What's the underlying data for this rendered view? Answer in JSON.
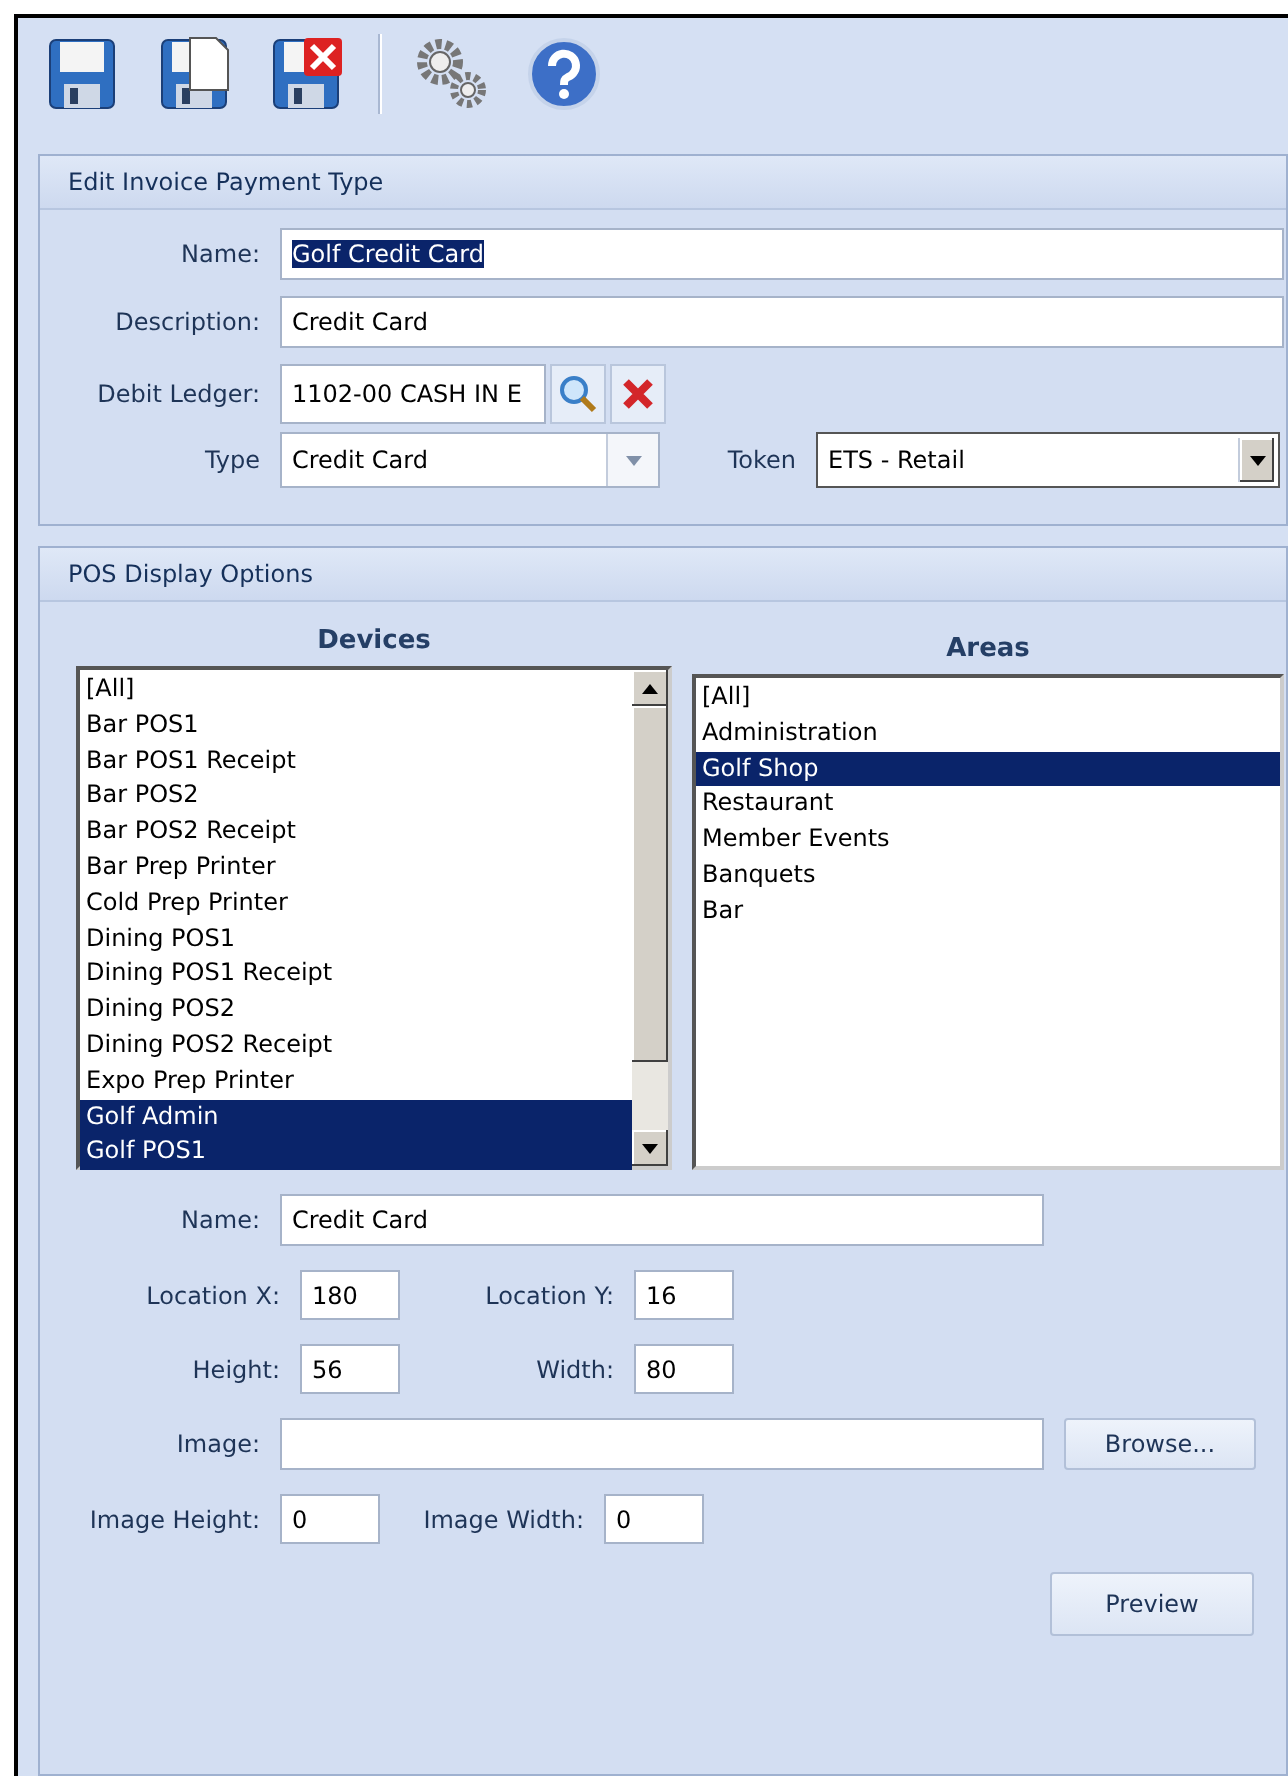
{
  "toolbar": {
    "buttons": [
      {
        "kind": "save"
      },
      {
        "kind": "save-copy"
      },
      {
        "kind": "save-close"
      },
      {
        "kind": "separator"
      },
      {
        "kind": "settings"
      },
      {
        "kind": "help"
      }
    ]
  },
  "edit_panel": {
    "title": "Edit Invoice Payment Type",
    "name": {
      "label": "Name:",
      "value": "Golf Credit Card",
      "text_selected": true
    },
    "description": {
      "label": "Description:",
      "value": "Credit Card"
    },
    "debit_ledger": {
      "label": "Debit Ledger:",
      "value": "1102-00 CASH IN E"
    },
    "type": {
      "label": "Type",
      "value": "Credit Card"
    },
    "token": {
      "label": "Token",
      "value": "ETS - Retail"
    }
  },
  "pos_panel": {
    "title": "POS Display Options",
    "devices": {
      "title": "Devices",
      "items": [
        {
          "label": "[All]",
          "selected": false
        },
        {
          "label": "Bar POS1",
          "selected": false
        },
        {
          "label": "Bar POS1 Receipt",
          "selected": false
        },
        {
          "label": "Bar POS2",
          "selected": false
        },
        {
          "label": "Bar POS2 Receipt",
          "selected": false
        },
        {
          "label": "Bar Prep Printer",
          "selected": false
        },
        {
          "label": "Cold Prep Printer",
          "selected": false
        },
        {
          "label": "Dining POS1",
          "selected": false
        },
        {
          "label": "Dining POS1 Receipt",
          "selected": false
        },
        {
          "label": "Dining POS2",
          "selected": false
        },
        {
          "label": "Dining POS2 Receipt",
          "selected": false
        },
        {
          "label": "Expo Prep Printer",
          "selected": false
        },
        {
          "label": "Golf Admin",
          "selected": true
        },
        {
          "label": "Golf POS1",
          "selected": true
        }
      ]
    },
    "areas": {
      "title": "Areas",
      "items": [
        {
          "label": "[All]",
          "selected": false
        },
        {
          "label": "Administration",
          "selected": false
        },
        {
          "label": "Golf Shop",
          "selected": true
        },
        {
          "label": "Restaurant",
          "selected": false
        },
        {
          "label": "Member Events",
          "selected": false
        },
        {
          "label": "Banquets",
          "selected": false
        },
        {
          "label": "Bar",
          "selected": false
        }
      ]
    },
    "name": {
      "label": "Name:",
      "value": "Credit Card"
    },
    "location_x": {
      "label": "Location X:",
      "value": "180"
    },
    "location_y": {
      "label": "Location Y:",
      "value": "16"
    },
    "height": {
      "label": "Height:",
      "value": "56"
    },
    "width": {
      "label": "Width:",
      "value": "80"
    },
    "image": {
      "label": "Image:"
    },
    "browse_button": "Browse...",
    "image_height": {
      "label": "Image Height:",
      "value": "0"
    },
    "image_width": {
      "label": "Image Width:",
      "value": "0"
    },
    "preview_button": "Preview"
  }
}
